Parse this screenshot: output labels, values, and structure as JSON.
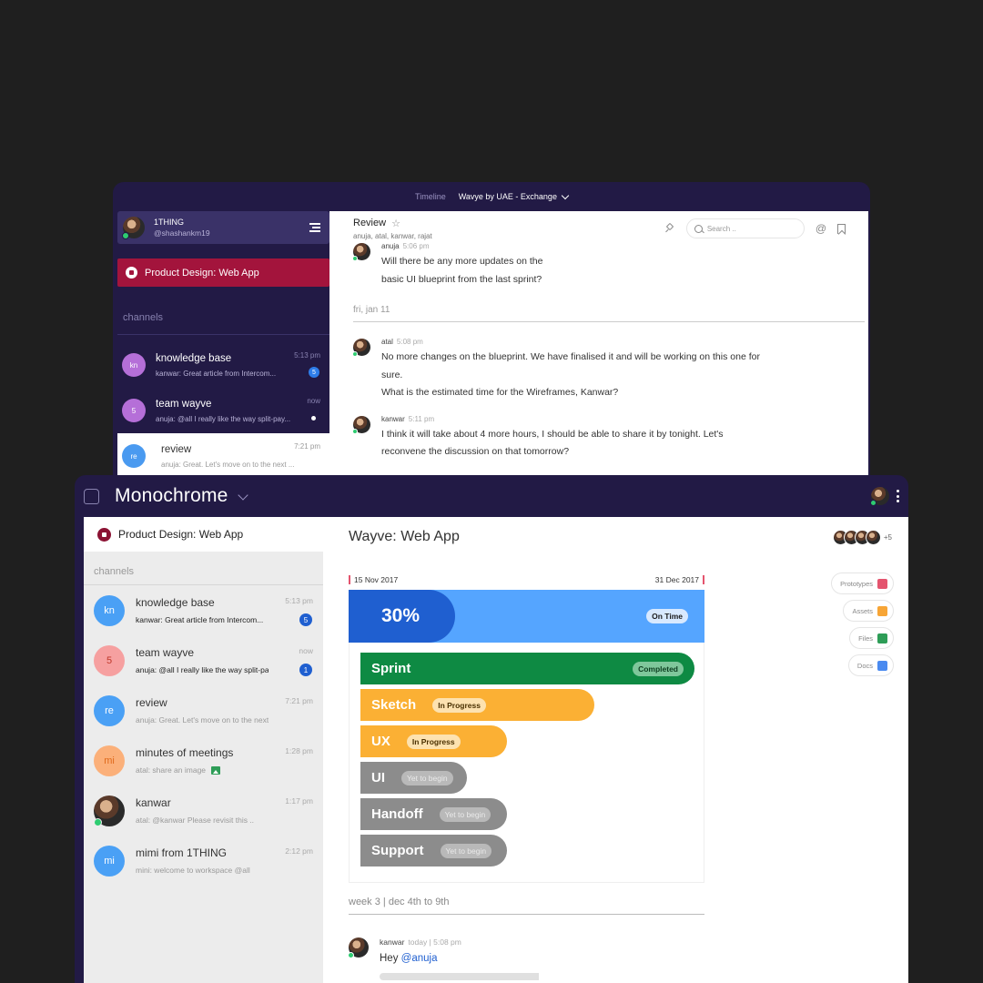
{
  "back": {
    "titlebar": {
      "tab": "Timeline",
      "workspace": "Wavye by UAE - Exchange"
    },
    "user": {
      "name": "1THING",
      "handle": "@shashankm19"
    },
    "project": "Product Design: Web App",
    "channels_label": "channels",
    "channels": [
      {
        "initials": "kn",
        "title": "knowledge base",
        "time": "5:13 pm",
        "preview": "kanwar: Great article from Intercom...",
        "count": "5",
        "color": "#b56fd8"
      },
      {
        "initials": "5",
        "title": "team wayve",
        "time": "now",
        "preview": "anuja: @all I really like the way split-pay...",
        "color": "#b56fd8"
      },
      {
        "initials": "re",
        "title": "review",
        "time": "7:21 pm",
        "preview": "anuja: Great. Let's move on to the next ...",
        "color": "#4a9af0"
      }
    ],
    "chat": {
      "title": "Review",
      "members": "anuja, atal, kanwar, rajat",
      "search_placeholder": "Search ..",
      "messages": [
        {
          "author": "anuja",
          "time": "5:06 pm",
          "lines": [
            "Will there be any more updates on the",
            "basic UI blueprint from the last sprint?"
          ]
        }
      ],
      "date_divider": "fri, jan 11",
      "messages_after": [
        {
          "author": "atal",
          "time": "5:08 pm",
          "lines": [
            "No more changes on the blueprint. We have finalised it and will be working on this one for",
            "sure.",
            "What is the estimated time for the Wireframes, Kanwar?"
          ]
        },
        {
          "author": "kanwar",
          "time": "5:11 pm",
          "lines": [
            "I think it will take about 4 more hours, I should be able to share it by tonight. Let's",
            "reconvene the discussion on that tomorrow?"
          ]
        }
      ]
    }
  },
  "front": {
    "workspace_title": "Monochrome",
    "project": "Product Design: Web App",
    "channels_label": "channels",
    "channels": [
      {
        "initials": "kn",
        "title": "knowledge base",
        "time": "5:13 pm",
        "preview": "kanwar: Great article from Intercom...",
        "count": "5",
        "bold": true,
        "bg": "#4aa0f5",
        "fg": "#ffffff"
      },
      {
        "initials": "5",
        "title": "team wayve",
        "time": "now",
        "preview": "anuja: @all I really like the way split-pay...",
        "count": "1",
        "bold": true,
        "bg": "#f6a0a0",
        "fg": "#c0392b"
      },
      {
        "initials": "re",
        "title": "review",
        "time": "7:21 pm",
        "preview": "anuja: Great. Let's move on to the next ...",
        "bg": "#4aa0f5",
        "fg": "#ffffff"
      },
      {
        "initials": "mi",
        "title": "minutes of meetings",
        "time": "1:28 pm",
        "preview": "atal: share an image",
        "bg": "#fbb07a",
        "fg": "#e06a1c",
        "image_icon": true
      },
      {
        "initials": "",
        "title": "kanwar",
        "time": "1:17 pm",
        "preview": "atal: @kanwar Please revisit this ..",
        "photo": true
      },
      {
        "initials": "mi",
        "title": "mimi from 1THING",
        "time": "2:12 pm",
        "preview": "mini: welcome to workspace @all",
        "bg": "#4aa0f5",
        "fg": "#ffffff"
      }
    ],
    "main": {
      "title": "Wayve: Web App",
      "members_more": "+5",
      "timeline": {
        "start": "15 Nov 2017",
        "end": "31 Dec 2017",
        "overall": {
          "percent": "30%",
          "progress": 0.3,
          "status": "On Time"
        },
        "phases": [
          {
            "name": "Sprint",
            "status": "Completed",
            "kind": "done",
            "width": 1.0
          },
          {
            "name": "Sketch",
            "status": "In Progress",
            "kind": "prog",
            "width": 0.7
          },
          {
            "name": "UX",
            "status": "In Progress",
            "kind": "prog",
            "width": 0.44
          },
          {
            "name": "UI",
            "status": "Yet to begin",
            "kind": "wait",
            "width": 0.32
          },
          {
            "name": "Handoff",
            "status": "Yet to begin",
            "kind": "wait",
            "width": 0.44
          },
          {
            "name": "Support",
            "status": "Yet to begin",
            "kind": "wait",
            "width": 0.44
          }
        ]
      },
      "assets": [
        {
          "label": "Prototypes",
          "icon": "invision-icon",
          "color": "#e4546e"
        },
        {
          "label": "Assets",
          "icon": "sketch-icon",
          "color": "#f7a536"
        },
        {
          "label": "Files",
          "icon": "drive-icon",
          "color": "#2e9d57"
        },
        {
          "label": "Docs",
          "icon": "docs-icon",
          "color": "#4a8af0"
        }
      ],
      "week_divider": "week 3 | dec 4th to 9th",
      "message": {
        "author": "kanwar",
        "time": "today | 5:08 pm",
        "greeting": "Hey",
        "mention": "@anuja"
      }
    }
  }
}
